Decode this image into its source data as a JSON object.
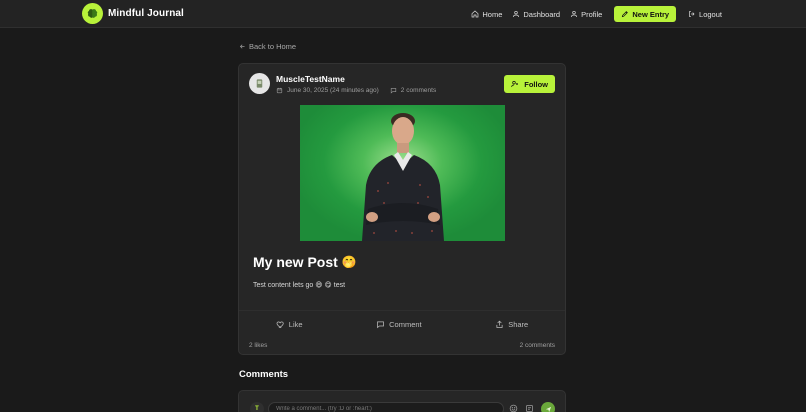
{
  "nav": {
    "brand": "Mindful Journal",
    "links": [
      {
        "label": "Home",
        "icon": "home-icon"
      },
      {
        "label": "Dashboard",
        "icon": "user-icon"
      },
      {
        "label": "Profile",
        "icon": "user-icon"
      }
    ],
    "new_entry_label": "New Entry",
    "logout_label": "Logout"
  },
  "back_label": "Back to Home",
  "post": {
    "author": "MuscleTestName",
    "date": "June 30, 2025 (24 minutes ago)",
    "comments_meta": "2 comments",
    "follow_label": "Follow",
    "title": "My new Post",
    "title_emoji": "🤭",
    "content": "Test content lets go 😄 😋 test",
    "actions": {
      "like": "Like",
      "comment": "Comment",
      "share": "Share"
    },
    "likes_count": "2 likes",
    "comments_count": "2 comments"
  },
  "comments": {
    "heading": "Comments",
    "avatar_initial": "T",
    "input_placeholder": "Write a comment... (try :D or :heart:)"
  },
  "colors": {
    "accent": "#b8f23a",
    "background": "#1a1a1a",
    "card": "#262626"
  }
}
